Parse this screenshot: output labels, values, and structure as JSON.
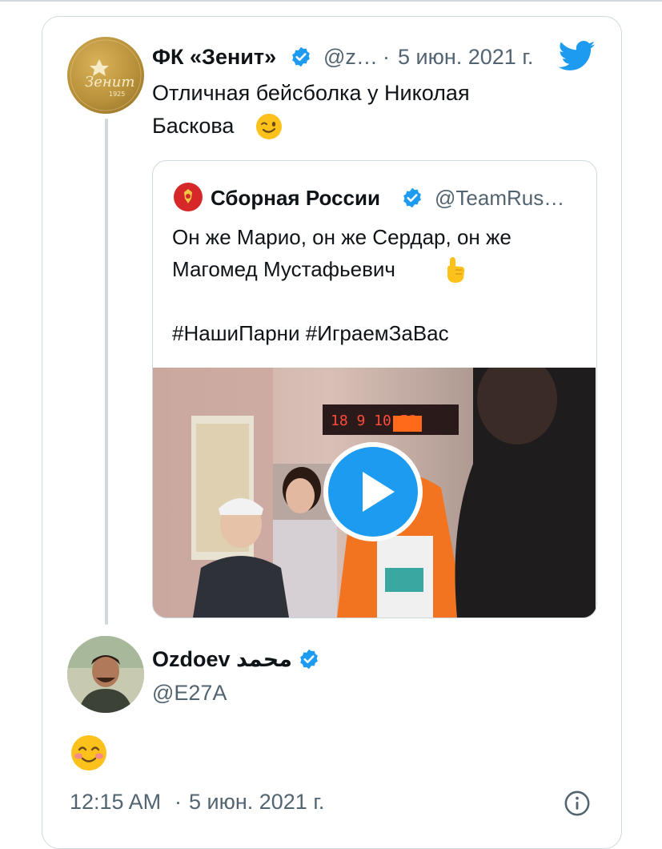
{
  "tweet": {
    "author_name": "ФК «Зенит»",
    "author_handle": "@z…",
    "separator": "·",
    "date": "5 июн. 2021 г.",
    "text_line1": "Отличная бейсболка у Николая",
    "text_line2": "Баскова",
    "emoji_wink": "winking-face"
  },
  "quoted_tweet": {
    "author_name": "Сборная России",
    "author_handle": "@TeamRus…",
    "text_line1": "Он же Марио, он же Сердар, он же",
    "text_line2": "Магомед Мустафьевич",
    "hashtags": "#НашиПарни #ИграемЗаВас",
    "media_type": "video",
    "scoreboard_text": "18 9  10 52"
  },
  "reply": {
    "author_name": "Ozdoev محمد",
    "author_handle": "@E27A",
    "emoji": "smiling-face-with-blush",
    "time": "12:15 AM",
    "separator": "·",
    "date": "5 июн. 2021 г."
  },
  "colors": {
    "twitter_blue": "#1d9bf0",
    "border": "#cfd9de",
    "muted_text": "#536471",
    "zenit_gold": "#c29a44"
  }
}
